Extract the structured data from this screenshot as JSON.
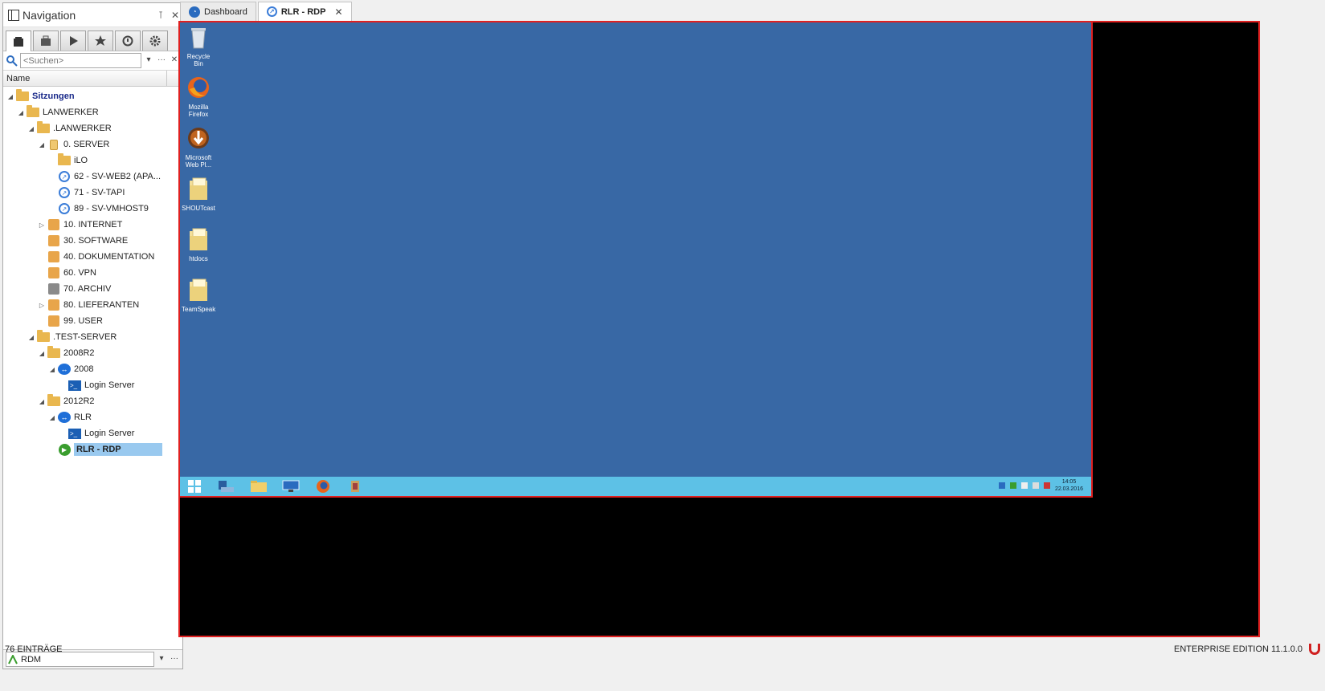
{
  "nav": {
    "title": "Navigation",
    "pin_icon": "⊺",
    "close_icon": "✕",
    "search_placeholder": "<Suchen>",
    "column_name": "Name",
    "bottom_value": "RDM",
    "tree": [
      {
        "label": "Sitzungen",
        "level": 0,
        "icon": "folder",
        "exp": "◢",
        "bold": true
      },
      {
        "label": "LANWERKER",
        "level": 1,
        "icon": "folder",
        "exp": "◢"
      },
      {
        "label": ".LANWERKER",
        "level": 2,
        "icon": "folder",
        "exp": "◢"
      },
      {
        "label": "0. SERVER",
        "level": 3,
        "icon": "server",
        "exp": "◢"
      },
      {
        "label": "iLO",
        "level": 4,
        "icon": "folder",
        "exp": ""
      },
      {
        "label": "62 - SV-WEB2 (APA...",
        "level": 4,
        "icon": "rdp",
        "exp": ""
      },
      {
        "label": "71 - SV-TAPI",
        "level": 4,
        "icon": "rdp",
        "exp": ""
      },
      {
        "label": "89 - SV-VMHOST9",
        "level": 4,
        "icon": "rdp",
        "exp": ""
      },
      {
        "label": "10. INTERNET",
        "level": 3,
        "icon": "orange",
        "exp": "▷"
      },
      {
        "label": "30. SOFTWARE",
        "level": 3,
        "icon": "orange",
        "exp": ""
      },
      {
        "label": "40. DOKUMENTATION",
        "level": 3,
        "icon": "orange",
        "exp": ""
      },
      {
        "label": "60. VPN",
        "level": 3,
        "icon": "orange",
        "exp": ""
      },
      {
        "label": "70. ARCHIV",
        "level": 3,
        "icon": "gray",
        "exp": ""
      },
      {
        "label": "80. LIEFERANTEN",
        "level": 3,
        "icon": "orange",
        "exp": "▷"
      },
      {
        "label": "99. USER",
        "level": 3,
        "icon": "orange",
        "exp": ""
      },
      {
        "label": ".TEST-SERVER",
        "level": 2,
        "icon": "folder",
        "exp": "◢"
      },
      {
        "label": "2008R2",
        "level": 3,
        "icon": "folder",
        "exp": "◢"
      },
      {
        "label": "2008",
        "level": 4,
        "icon": "tv",
        "exp": "◢"
      },
      {
        "label": "Login Server",
        "level": 5,
        "icon": "cmd",
        "exp": ""
      },
      {
        "label": "2012R2",
        "level": 3,
        "icon": "folder",
        "exp": "◢"
      },
      {
        "label": "RLR",
        "level": 4,
        "icon": "tv",
        "exp": "◢"
      },
      {
        "label": "Login Server",
        "level": 5,
        "icon": "cmd",
        "exp": ""
      },
      {
        "label": "RLR - RDP",
        "level": 4,
        "icon": "play",
        "exp": "",
        "selected": true
      }
    ]
  },
  "tabs": [
    {
      "label": "Dashboard",
      "icon": "dashboard-icon",
      "active": false
    },
    {
      "label": "RLR - RDP",
      "icon": "rdp-icon",
      "active": true,
      "close": "✕"
    }
  ],
  "desktop": {
    "icons": [
      {
        "label": "Recycle Bin",
        "icon": "recycle-bin-icon"
      },
      {
        "label": "Mozilla Firefox",
        "icon": "firefox-icon"
      },
      {
        "label": "Microsoft Web Pl...",
        "icon": "web-platform-icon"
      },
      {
        "label": "SHOUTcast",
        "icon": "folder-icon"
      },
      {
        "label": "htdocs",
        "icon": "folder-icon"
      },
      {
        "label": "TeamSpeak",
        "icon": "folder-icon"
      }
    ],
    "clock_time": "14:05",
    "clock_date": "22.03.2016"
  },
  "status": {
    "left": "76 EINTRÄGE",
    "right": "ENTERPRISE EDITION 11.1.0.0"
  },
  "colors": {
    "selection": "#99c9ef",
    "desktop": "#3868a5",
    "taskbar": "#5dc1e6",
    "border_highlight": "#e02020"
  }
}
